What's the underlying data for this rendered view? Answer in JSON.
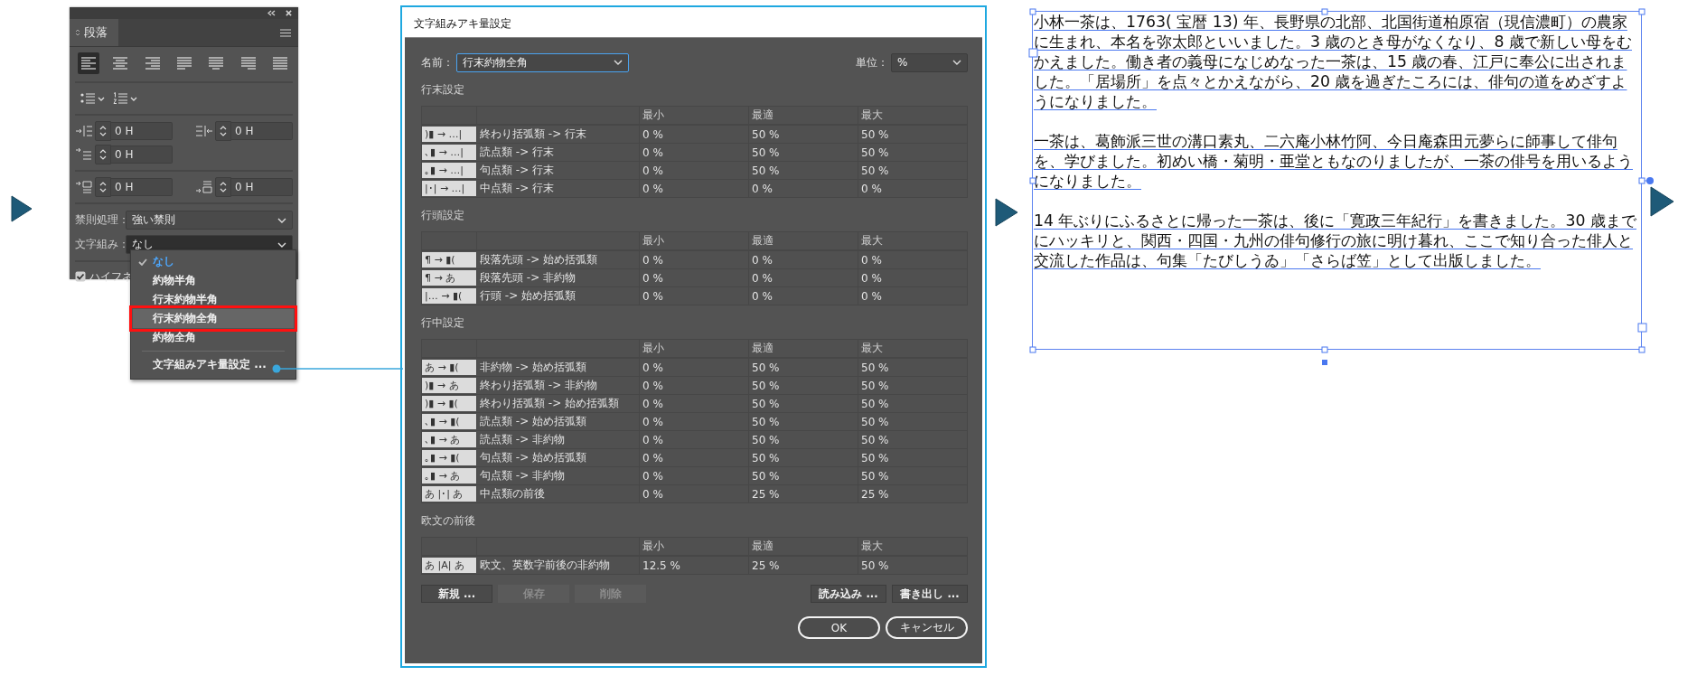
{
  "paragraph_panel": {
    "tab": "段落",
    "alignments": [
      {
        "kind": "left",
        "selected": true
      },
      {
        "kind": "center",
        "selected": false
      },
      {
        "kind": "right",
        "selected": false
      },
      {
        "kind": "justify-left",
        "selected": false
      },
      {
        "kind": "justify-center",
        "selected": false
      },
      {
        "kind": "justify-right",
        "selected": false
      },
      {
        "kind": "justify-all",
        "selected": false
      }
    ],
    "indents": [
      {
        "kind": "left",
        "value": "0 H"
      },
      {
        "kind": "right",
        "value": "0 H"
      },
      {
        "kind": "first-line",
        "value": "0 H"
      },
      {
        "kind": "space-before",
        "value": "0 H"
      },
      {
        "kind": "space-after",
        "value": "0 H"
      }
    ],
    "kinsoku": {
      "label": "禁則処理：",
      "value": "強い禁則"
    },
    "mojikumi": {
      "label": "文字組み：",
      "value": "なし",
      "open": true
    },
    "hyphenation": {
      "label": "ハイフネ",
      "checked": true
    }
  },
  "mojikumi_menu": {
    "items": [
      {
        "label": "なし",
        "checked": true,
        "selected": false,
        "outlined": false
      },
      {
        "label": "約物半角",
        "checked": false,
        "selected": false,
        "outlined": false
      },
      {
        "label": "行末約物半角",
        "checked": false,
        "selected": false,
        "outlined": false
      },
      {
        "label": "行末約物全角",
        "checked": false,
        "selected": true,
        "outlined": true
      },
      {
        "label": "約物全角",
        "checked": false,
        "selected": false,
        "outlined": false
      }
    ],
    "settings_item": "文字組みアキ量設定 ..."
  },
  "dialog": {
    "title": "文字組みアキ量設定",
    "name_label": "名前：",
    "name_value": "行末約物全角",
    "unit_label": "単位：",
    "unit_value": "%",
    "sections": [
      {
        "title": "行末設定",
        "columns": [
          "最小",
          "最適",
          "最大"
        ],
        "rows": [
          {
            "glyph": ")▮ → …|",
            "label": "終わり括弧類 -> 行末",
            "min": "0 %",
            "opt": "50 %",
            "max": "50 %"
          },
          {
            "glyph": "､▮ → …|",
            "label": "読点類 -> 行末",
            "min": "0 %",
            "opt": "50 %",
            "max": "50 %"
          },
          {
            "glyph": "｡▮ → …|",
            "label": "句点類 -> 行末",
            "min": "0 %",
            "opt": "50 %",
            "max": "50 %"
          },
          {
            "glyph": "|･| → …|",
            "label": "中点類 -> 行末",
            "min": "0 %",
            "opt": "0 %",
            "max": "0 %"
          }
        ]
      },
      {
        "title": "行頭設定",
        "columns": [
          "最小",
          "最適",
          "最大"
        ],
        "rows": [
          {
            "glyph": "¶ → ▮(",
            "label": "段落先頭 -> 始め括弧類",
            "min": "0 %",
            "opt": "0 %",
            "max": "0 %"
          },
          {
            "glyph": "¶ → あ",
            "label": "段落先頭 -> 非約物",
            "min": "0 %",
            "opt": "0 %",
            "max": "0 %"
          },
          {
            "glyph": "|… → ▮(",
            "label": "行頭 -> 始め括弧類",
            "min": "0 %",
            "opt": "0 %",
            "max": "0 %"
          }
        ]
      },
      {
        "title": "行中設定",
        "columns": [
          "最小",
          "最適",
          "最大"
        ],
        "rows": [
          {
            "glyph": "あ → ▮(",
            "label": "非約物 -> 始め括弧類",
            "min": "0 %",
            "opt": "50 %",
            "max": "50 %"
          },
          {
            "glyph": ")▮ → あ",
            "label": "終わり括弧類 -> 非約物",
            "min": "0 %",
            "opt": "50 %",
            "max": "50 %"
          },
          {
            "glyph": ")▮ → ▮(",
            "label": "終わり括弧類 -> 始め括弧類",
            "min": "0 %",
            "opt": "50 %",
            "max": "50 %"
          },
          {
            "glyph": "､▮ → ▮(",
            "label": "読点類 -> 始め括弧類",
            "min": "0 %",
            "opt": "50 %",
            "max": "50 %"
          },
          {
            "glyph": "､▮ → あ",
            "label": "読点類 -> 非約物",
            "min": "0 %",
            "opt": "50 %",
            "max": "50 %"
          },
          {
            "glyph": "｡▮ → ▮(",
            "label": "句点類 -> 始め括弧類",
            "min": "0 %",
            "opt": "50 %",
            "max": "50 %"
          },
          {
            "glyph": "｡▮ → あ",
            "label": "句点類 -> 非約物",
            "min": "0 %",
            "opt": "50 %",
            "max": "50 %"
          },
          {
            "glyph": "あ |･| あ",
            "label": "中点類の前後",
            "min": "0 %",
            "opt": "25 %",
            "max": "25 %"
          }
        ]
      },
      {
        "title": "欧文の前後",
        "columns": [
          "最小",
          "最適",
          "最大"
        ],
        "rows": [
          {
            "glyph": "あ |A| あ",
            "label": "欧文、英数字前後の非約物",
            "min": "12.5 %",
            "opt": "25 %",
            "max": "50 %"
          }
        ]
      }
    ],
    "left_buttons": [
      {
        "label": "新規 ...",
        "disabled": false
      },
      {
        "label": "保存",
        "disabled": true
      },
      {
        "label": "削除",
        "disabled": true
      }
    ],
    "right_buttons": [
      {
        "label": "読み込み ...",
        "disabled": false
      },
      {
        "label": "書き出し ...",
        "disabled": false
      }
    ],
    "ok": "OK",
    "cancel": "キャンセル"
  },
  "text_frame": {
    "paragraphs": [
      "小林一茶は、1763( 宝暦 13) 年、長野県の北部、北国街道柏原宿（現信濃町）の農家に生まれ、本名を弥太郎といいました。3 歳のとき母がなくなり、8 歳で新しい母をむかえました。働き者の義母になじめなった一茶は、15 歳の春、江戸に奉公に出されました。「居場所」を点々とかえながら、20 歳を過ぎたころには、俳句の道をめざすようになりました。",
      "一茶は、葛飾派三世の溝口素丸、二六庵小林竹阿、今日庵森田元夢らに師事して俳句を、学びました。初めい橋・菊明・亜堂ともなのりましたが、一茶の俳号を用いるようになりました。",
      "14 年ぶりにふるさとに帰った一茶は、後に「寛政三年紀行」を書きました。30 歳までにハッキリと、関西・四国・九州の俳句修行の旅に明け暮れ、ここで知り合った俳人と交流した作品は、句集「たびしうゐ」「さらば笠」として出版しました。"
    ]
  }
}
